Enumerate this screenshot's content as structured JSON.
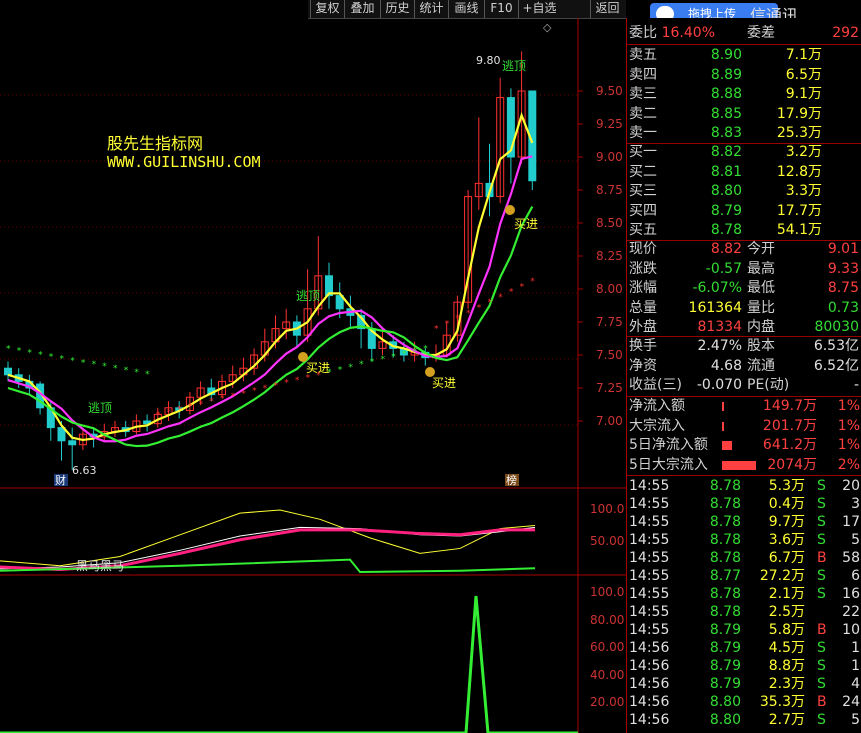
{
  "toolbar": {
    "buttons": [
      "复权",
      "叠加",
      "历史",
      "统计",
      "画线",
      "F10",
      "+自选",
      "返回"
    ],
    "partial_title": "信通讯",
    "upload_label": "拖拽上传"
  },
  "watermark": {
    "line1": "股先生指标网",
    "line2": "WWW.GUILINSHU.COM"
  },
  "price_axis": [
    "9.50",
    "9.25",
    "9.00",
    "8.75",
    "8.50",
    "8.25",
    "8.00",
    "7.75",
    "7.50",
    "7.25",
    "7.00"
  ],
  "osc_axis": [
    "100.0",
    "50.00"
  ],
  "vol_axis": [
    "100.0",
    "80.00",
    "60.00",
    "40.00",
    "20.00"
  ],
  "annotations": {
    "high_label": "9.80",
    "low_label": "6.63",
    "escape_top": "逃顶",
    "buy_in": "买进",
    "badge_cai": "财",
    "badge_bang": "榜",
    "osc_label": "黑马黑马"
  },
  "colors": {
    "up": "#ff3030",
    "down": "#22cccc",
    "ma1": "#ffff33",
    "ma2": "#ff33ff",
    "ma3": "#33ee33",
    "bg": "#000000"
  },
  "chart_data": {
    "type": "line",
    "ylim": [
      6.6,
      9.8
    ],
    "candles_summary": {
      "high": 9.8,
      "low": 6.63
    }
  },
  "quote": {
    "weibi": {
      "label": "委比",
      "value": "16.40%",
      "label2": "委差",
      "value2": "292"
    },
    "asks": [
      {
        "label": "卖五",
        "price": "8.90",
        "vol": "7.1万"
      },
      {
        "label": "卖四",
        "price": "8.89",
        "vol": "6.5万"
      },
      {
        "label": "卖三",
        "price": "8.88",
        "vol": "9.1万"
      },
      {
        "label": "卖二",
        "price": "8.85",
        "vol": "17.9万"
      },
      {
        "label": "卖一",
        "price": "8.83",
        "vol": "25.3万"
      }
    ],
    "bids": [
      {
        "label": "买一",
        "price": "8.82",
        "vol": "3.2万"
      },
      {
        "label": "买二",
        "price": "8.81",
        "vol": "12.8万"
      },
      {
        "label": "买三",
        "price": "8.80",
        "vol": "3.3万"
      },
      {
        "label": "买四",
        "price": "8.79",
        "vol": "17.7万"
      },
      {
        "label": "买五",
        "price": "8.78",
        "vol": "54.1万"
      }
    ],
    "stats": [
      {
        "l1": "现价",
        "v1": "8.82",
        "c1": "red",
        "l2": "今开",
        "v2": "9.01",
        "c2": "red"
      },
      {
        "l1": "涨跌",
        "v1": "-0.57",
        "c1": "green",
        "l2": "最高",
        "v2": "9.33",
        "c2": "red"
      },
      {
        "l1": "涨幅",
        "v1": "-6.07%",
        "c1": "green",
        "l2": "最低",
        "v2": "8.75",
        "c2": "red"
      },
      {
        "l1": "总量",
        "v1": "161364",
        "c1": "yellow",
        "l2": "量比",
        "v2": "0.73",
        "c2": "green"
      },
      {
        "l1": "外盘",
        "v1": "81334",
        "c1": "red",
        "l2": "内盘",
        "v2": "80030",
        "c2": "green"
      }
    ],
    "stats2": [
      {
        "l1": "换手",
        "v1": "2.47%",
        "l2": "股本",
        "v2": "6.53亿"
      },
      {
        "l1": "净资",
        "v1": "4.68",
        "l2": "流通",
        "v2": "6.52亿"
      },
      {
        "l1": "收益(三)",
        "v1": "-0.070",
        "l2": "PE(动)",
        "v2": "-"
      }
    ],
    "flows": [
      {
        "label": "净流入额",
        "value": "149.7万",
        "pct": "1%",
        "bar": 2
      },
      {
        "label": "大宗流入",
        "value": "201.7万",
        "pct": "1%",
        "bar": 2
      },
      {
        "label": "5日净流入额",
        "value": "641.2万",
        "pct": "1%",
        "bar": 10
      },
      {
        "label": "5日大宗流入",
        "value": "2074万",
        "pct": "2%",
        "bar": 34
      }
    ],
    "ticks": [
      {
        "t": "14:55",
        "p": "8.78",
        "v": "5.3万",
        "s": "S",
        "n": "20"
      },
      {
        "t": "14:55",
        "p": "8.78",
        "v": "0.4万",
        "s": "S",
        "n": "3"
      },
      {
        "t": "14:55",
        "p": "8.78",
        "v": "9.7万",
        "s": "S",
        "n": "17"
      },
      {
        "t": "14:55",
        "p": "8.78",
        "v": "3.6万",
        "s": "S",
        "n": "5"
      },
      {
        "t": "14:55",
        "p": "8.78",
        "v": "6.7万",
        "s": "B",
        "n": "58"
      },
      {
        "t": "14:55",
        "p": "8.77",
        "v": "27.2万",
        "s": "S",
        "n": "6"
      },
      {
        "t": "14:55",
        "p": "8.78",
        "v": "2.1万",
        "s": "S",
        "n": "16"
      },
      {
        "t": "14:55",
        "p": "8.78",
        "v": "2.5万",
        "s": "",
        "n": "22"
      },
      {
        "t": "14:55",
        "p": "8.79",
        "v": "5.8万",
        "s": "B",
        "n": "10"
      },
      {
        "t": "14:56",
        "p": "8.79",
        "v": "4.5万",
        "s": "S",
        "n": "1"
      },
      {
        "t": "14:56",
        "p": "8.79",
        "v": "8.8万",
        "s": "S",
        "n": "1"
      },
      {
        "t": "14:56",
        "p": "8.79",
        "v": "2.3万",
        "s": "S",
        "n": "4"
      },
      {
        "t": "14:56",
        "p": "8.80",
        "v": "35.3万",
        "s": "B",
        "n": "24"
      },
      {
        "t": "14:56",
        "p": "8.80",
        "v": "2.7万",
        "s": "S",
        "n": "5"
      }
    ]
  }
}
